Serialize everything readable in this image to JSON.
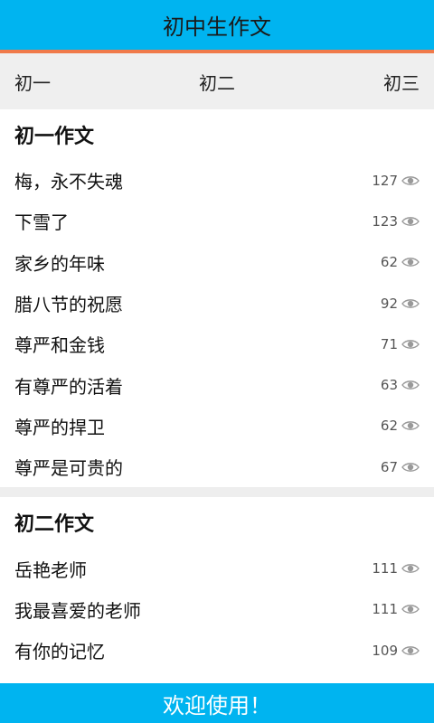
{
  "header": {
    "title": "初中生作文"
  },
  "tabs": [
    {
      "label": "初一"
    },
    {
      "label": "初二"
    },
    {
      "label": "初三"
    }
  ],
  "sections": [
    {
      "heading": "初一作文",
      "items": [
        {
          "title": "梅，永不失魂",
          "views": "127"
        },
        {
          "title": "下雪了",
          "views": "123"
        },
        {
          "title": "家乡的年味",
          "views": "62"
        },
        {
          "title": "腊八节的祝愿",
          "views": "92"
        },
        {
          "title": "尊严和金钱",
          "views": "71"
        },
        {
          "title": "有尊严的活着",
          "views": "63"
        },
        {
          "title": "尊严的捍卫",
          "views": "62"
        },
        {
          "title": "尊严是可贵的",
          "views": "67"
        }
      ]
    },
    {
      "heading": "初二作文",
      "items": [
        {
          "title": "岳艳老师",
          "views": "111"
        },
        {
          "title": "我最喜爱的老师",
          "views": "111"
        },
        {
          "title": "有你的记忆",
          "views": "109"
        }
      ]
    }
  ],
  "footer": {
    "text": "欢迎使用！"
  },
  "icons": {
    "view_count": "eye-icon"
  },
  "colors": {
    "primary": "#00b4f0",
    "accent": "#f07a4a",
    "tab_bg": "#efefef"
  }
}
